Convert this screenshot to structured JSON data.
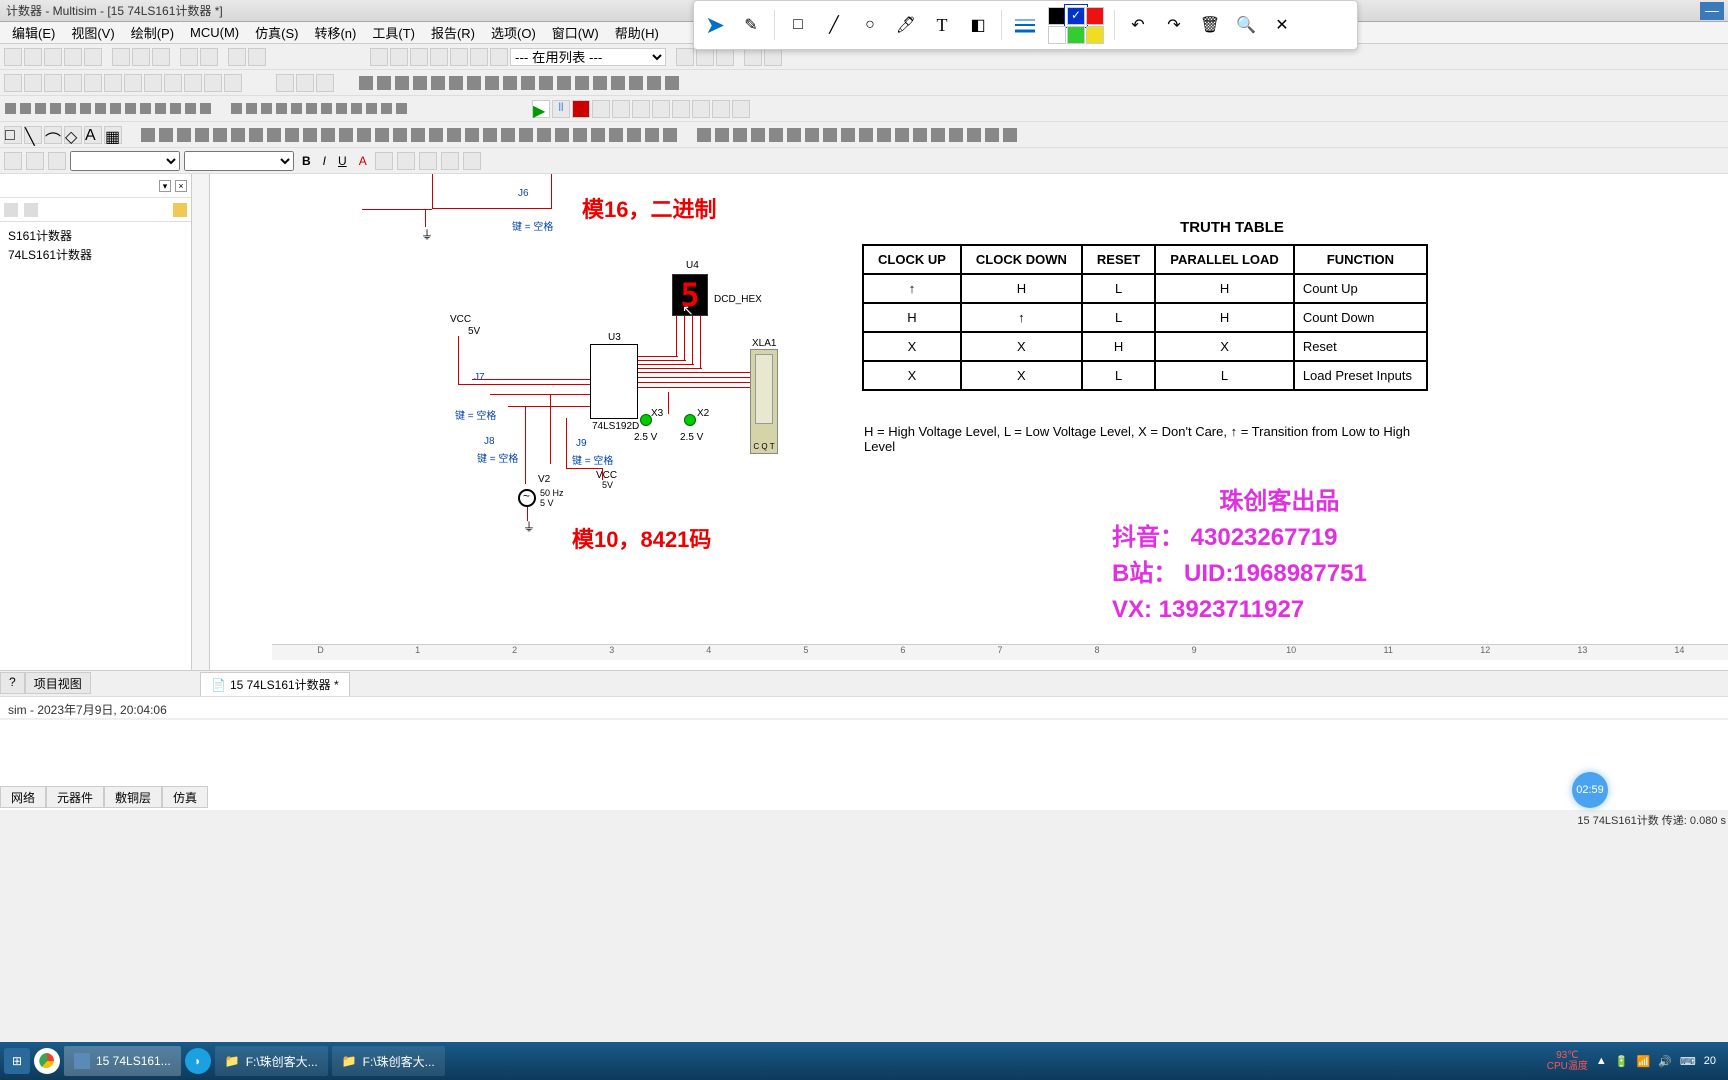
{
  "title": "计数器 - Multisim - [15 74LS161计数器 *]",
  "menu": [
    "编辑(E)",
    "视图(V)",
    "绘制(P)",
    "MCU(M)",
    "仿真(S)",
    "转移(n)",
    "工具(T)",
    "报告(R)",
    "选项(O)",
    "窗口(W)",
    "帮助(H)"
  ],
  "toolbar_select": "--- 在用列表 ---",
  "side": {
    "items": [
      "S161计数器",
      "74LS161计数器"
    ],
    "bottom_tabs": [
      "?",
      "项目视图"
    ]
  },
  "doc_tab": "15 74LS161计数器 *",
  "schematic": {
    "title1": "模16，二进制",
    "title2": "模10，8421码",
    "j6": "J6",
    "j6_key": "键 = 空格",
    "u4": "U4",
    "u4_type": "DCD_HEX",
    "u4_digit": "5",
    "u3": "U3",
    "u3_type": "74LS192D",
    "xla1": "XLA1",
    "xla1_pins": "C  Q  T",
    "vcc": "VCC",
    "vcc_5v": "5V",
    "j7": "J7",
    "j8": "J8",
    "j9": "J9",
    "key": "键 = 空格",
    "x2": "X2",
    "x3": "X3",
    "v25": "2.5 V",
    "v2": "V2",
    "v2_freq": "50 Hz",
    "v2_volt": "5 V"
  },
  "truth_table": {
    "title": "TRUTH TABLE",
    "headers": [
      "CLOCK UP",
      "CLOCK DOWN",
      "RESET",
      "PARALLEL LOAD",
      "FUNCTION"
    ],
    "rows": [
      [
        "↑",
        "H",
        "L",
        "H",
        "Count Up"
      ],
      [
        "H",
        "↑",
        "L",
        "H",
        "Count Down"
      ],
      [
        "X",
        "X",
        "H",
        "X",
        "Reset"
      ],
      [
        "X",
        "X",
        "L",
        "L",
        "Load Preset Inputs"
      ]
    ],
    "legend": "H = High Voltage Level, L = Low Voltage Level, X = Don't Care, ↑ = Transition from Low to High Level"
  },
  "watermark": {
    "l1": "珠创客出品",
    "l2": "抖音：  43023267719",
    "l3": "B站：  UID:1968987751",
    "l4": "VX:    13923711927"
  },
  "hruler": [
    "D",
    "1",
    "2",
    "3",
    "4",
    "5",
    "6",
    "7",
    "8",
    "9",
    "10",
    "11",
    "12",
    "13",
    "14"
  ],
  "status": "sim  -  2023年7月9日, 20:04:06",
  "bottom_tabs": [
    "网络",
    "元器件",
    "敷铜层",
    "仿真"
  ],
  "right_status": "15 74LS161计数  传递: 0.080 s",
  "video_time": "02:59",
  "taskbar": {
    "items": [
      "15 74LS161...",
      "",
      "F:\\珠创客大...",
      "F:\\珠创客大..."
    ],
    "temp1": "93℃",
    "temp2": "CPU温度",
    "time": "20"
  },
  "float_colors": [
    "#000000",
    "#0033cc",
    "#ee1111",
    "#ffffff",
    "#33cc33",
    "#eedd22"
  ]
}
